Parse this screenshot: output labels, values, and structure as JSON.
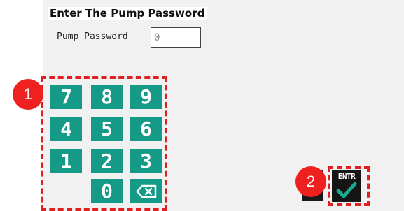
{
  "title": "Enter The Pump Password",
  "password": {
    "label": "Pump Password",
    "value": "0"
  },
  "keypad": {
    "keys": [
      "7",
      "8",
      "9",
      "4",
      "5",
      "6",
      "1",
      "2",
      "3",
      "0"
    ],
    "backspace_icon": "backspace-icon"
  },
  "enter_button": {
    "label": "ENTR",
    "icon": "check-icon"
  },
  "annotations": {
    "keypad_badge": "1",
    "enter_badge": "2"
  },
  "colors": {
    "key": "#149a86",
    "annotation": "#e02020",
    "check": "#19a98f"
  }
}
